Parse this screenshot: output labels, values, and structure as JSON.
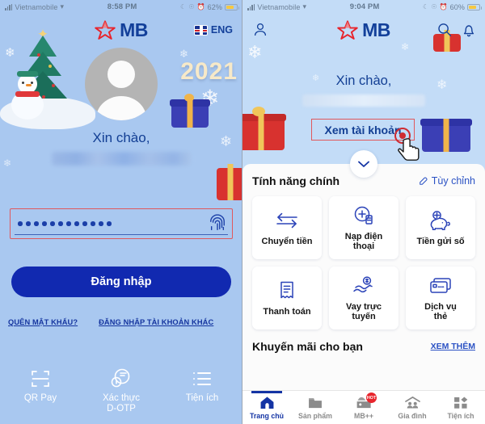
{
  "left_phone": {
    "statusbar": {
      "carrier": "Vietnamobile",
      "time": "8:58 PM",
      "battery": "62%"
    },
    "header": {
      "logo_text": "MB",
      "language": "ENG"
    },
    "greeting": "Xin chào,",
    "password": {
      "dot_count": 12,
      "fingerprint_icon": "fingerprint-icon"
    },
    "login_button": "Đăng nhập",
    "links": {
      "forgot": "QUÊN MẬT KHẨU?",
      "other_account": "ĐĂNG NHẬP TÀI KHOẢN KHÁC"
    },
    "quick_actions": [
      {
        "label": "QR Pay",
        "icon": "qr-scan-icon"
      },
      {
        "label": "Xác thực\nD-OTP",
        "line1": "Xác thực",
        "line2": "D-OTP",
        "icon": "d-otp-icon"
      },
      {
        "label": "Tiện ích",
        "icon": "list-icon"
      }
    ],
    "decor": {
      "year": "2021"
    }
  },
  "right_phone": {
    "statusbar": {
      "carrier": "Vietnamobile",
      "time": "9:04 PM",
      "battery": "60%"
    },
    "header": {
      "logo_text": "MB",
      "person_icon": "person-icon",
      "search_icon": "search-icon",
      "bell_icon": "bell-icon"
    },
    "greeting": "Xin chào,",
    "view_account_button": "Xem tài khoản",
    "expand_icon": "chevron-down-icon",
    "features": {
      "title": "Tính năng chính",
      "customize_link": "Tùy chỉnh",
      "customize_icon": "pencil-icon",
      "items": [
        {
          "label": "Chuyển tiền",
          "icon": "transfer-arrows-icon"
        },
        {
          "label": "Nạp điện thoại",
          "line1": "Nạp điện",
          "line2": "thoại",
          "icon": "topup-icon"
        },
        {
          "label": "Tiền gửi số",
          "icon": "piggy-bank-icon"
        },
        {
          "label": "Thanh toán",
          "icon": "receipt-icon"
        },
        {
          "label": "Vay trực tuyến",
          "line1": "Vay trực",
          "line2": "tuyến",
          "icon": "online-loan-icon"
        },
        {
          "label": "Dịch vụ thẻ",
          "line1": "Dịch vụ",
          "line2": "thẻ",
          "icon": "card-icon"
        }
      ]
    },
    "promo": {
      "title": "Khuyến mãi cho bạn",
      "more_link": "XEM THÊM"
    },
    "tabbar": [
      {
        "label": "Trang chủ",
        "icon": "home-icon",
        "active": true
      },
      {
        "label": "Sản phẩm",
        "icon": "products-icon",
        "active": false
      },
      {
        "label": "MB++",
        "icon": "mbplus-icon",
        "active": false,
        "badge": "HOT"
      },
      {
        "label": "Gia đình",
        "icon": "family-icon",
        "active": false
      },
      {
        "label": "Tiện ích",
        "icon": "utilities-grid-icon",
        "active": false
      }
    ]
  },
  "colors": {
    "brand_blue": "#13409a",
    "brand_red": "#e8242c",
    "login_button": "#1129b0",
    "annotation_red": "#e0585c",
    "left_bg": "#a9c8f0",
    "right_bg": "#c3dcf7"
  }
}
